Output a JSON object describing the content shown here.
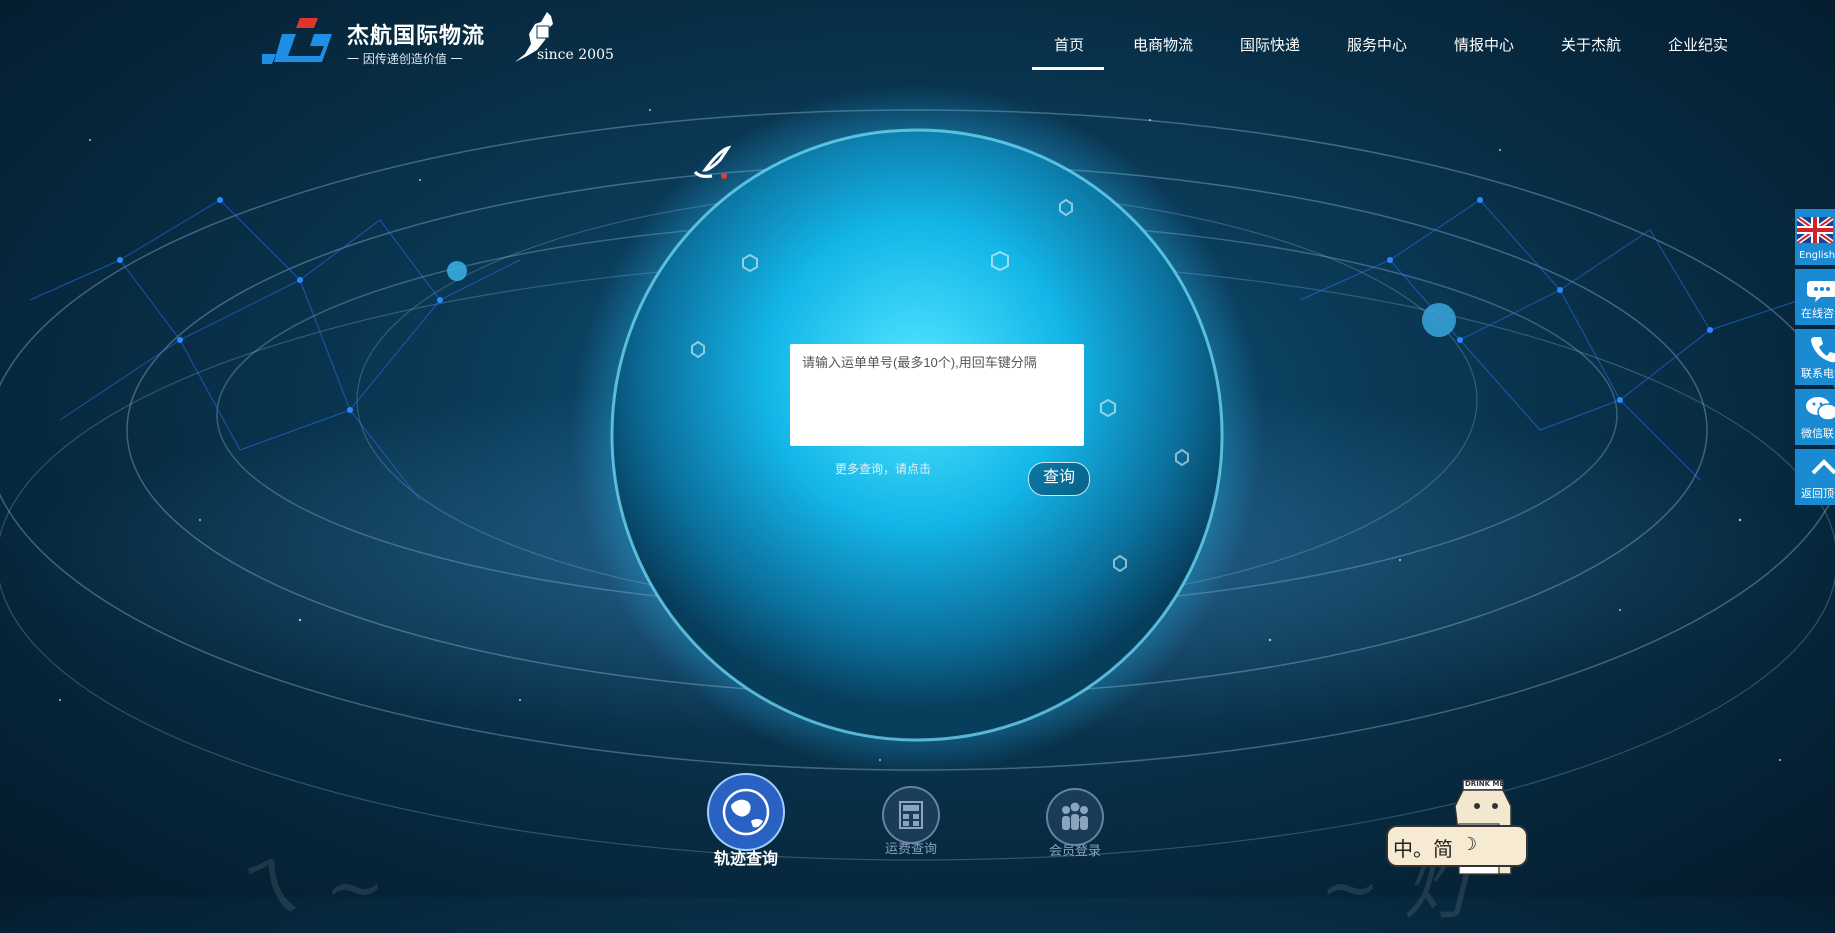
{
  "brand": {
    "name": "杰航国际物流",
    "slogan": "一  因传递创造价值  一",
    "since": "since 2005"
  },
  "nav": {
    "items": [
      {
        "label": "首页",
        "active": true
      },
      {
        "label": "电商物流"
      },
      {
        "label": "国际快递"
      },
      {
        "label": "服务中心"
      },
      {
        "label": "情报中心"
      },
      {
        "label": "关于杰航"
      },
      {
        "label": "企业纪实"
      }
    ]
  },
  "search": {
    "placeholder": "请输入运单单号(最多10个),用回车键分隔",
    "more_text": "更多查询，请点击",
    "button_label": "查询"
  },
  "features": [
    {
      "label": "轨迹查询",
      "icon": "globe-icon",
      "active": true
    },
    {
      "label": "运费查询",
      "icon": "calculator-icon"
    },
    {
      "label": "会员登录",
      "icon": "members-icon"
    }
  ],
  "sidebar": {
    "items": [
      {
        "label": "English",
        "icon": "uk-flag-icon"
      },
      {
        "label": "在线咨询",
        "icon": "chat-bubble-icon"
      },
      {
        "label": "联系电话",
        "icon": "phone-icon"
      },
      {
        "label": "微信联系",
        "icon": "wechat-icon"
      },
      {
        "label": "返回顶部",
        "icon": "arrow-up-icon"
      }
    ]
  },
  "mascot": {
    "text": "中。简",
    "box_label": "DRINK ME"
  },
  "colors": {
    "accent": "#1a8bd3",
    "background": "#0a3a57",
    "active_feature": "#2a62c4"
  }
}
